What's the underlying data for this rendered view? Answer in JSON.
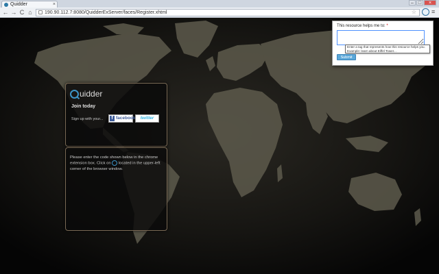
{
  "browser": {
    "tab_title": "Quidder",
    "tab_close": "×",
    "url": "190.90.112.7:8080/QuidderExServer/faces/Register.xhtml",
    "back_glyph": "←",
    "forward_glyph": "→",
    "reload_glyph": "C",
    "home_glyph": "⌂",
    "star_glyph": "☆",
    "wrench_glyph": "≡",
    "minimize_glyph": "–",
    "maximize_glyph": "□",
    "close_glyph": "×"
  },
  "login_card": {
    "logo_text": "uidder",
    "join_title": "Join today",
    "signup_label": "Sign up with your...",
    "facebook_label": "facebook",
    "facebook_f": "f",
    "twitter_label": "twitter"
  },
  "code_card": {
    "instructions_part1": "Please enter the code shown below in the chrome extension box. Click on",
    "instructions_part2": "located in the upper-left corner of the browser window."
  },
  "popup": {
    "label": "This resource helps me to:",
    "required_mark": "*",
    "input_value": "",
    "tooltip": "Enter a tag that represents how this resource helps you. Example: learn about Eiffel Tower...",
    "submit_label": "Submit"
  },
  "colors": {
    "accent": "#3d95c8",
    "facebook": "#3b5998",
    "twitter": "#33b5e5"
  }
}
